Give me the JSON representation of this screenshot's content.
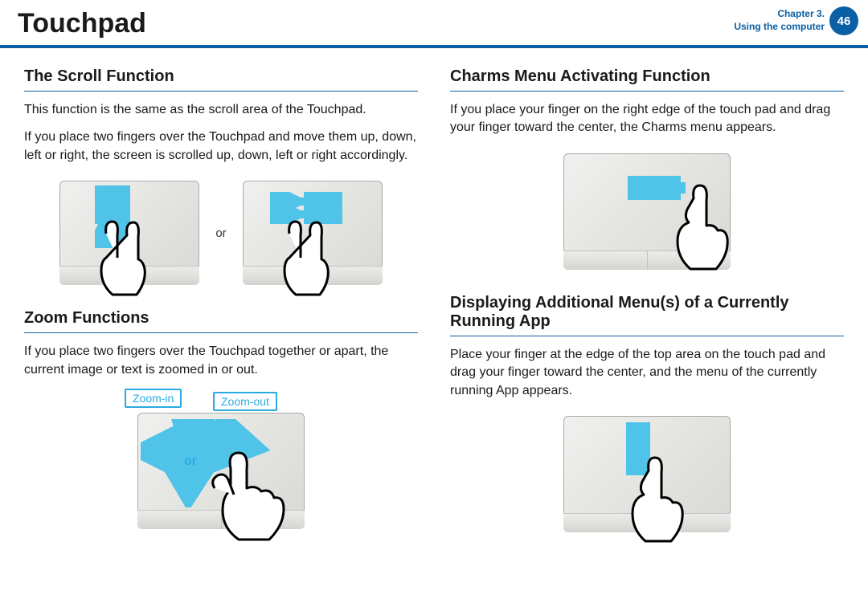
{
  "header": {
    "title": "Touchpad",
    "chapter_line1": "Chapter 3.",
    "chapter_line2": "Using the computer",
    "page_number": "46"
  },
  "left": {
    "scroll": {
      "heading": "The Scroll Function",
      "p1": "This function is the same as the scroll area of the Touchpad.",
      "p2": "If you place two fingers over the Touchpad and move them up, down, left or right, the screen is scrolled up, down, left or right accordingly.",
      "or": "or"
    },
    "zoom": {
      "heading": "Zoom Functions",
      "p1": "If you place two fingers over the Touchpad together or apart, the current image or text is zoomed in or out.",
      "zoom_in": "Zoom-in",
      "zoom_out": "Zoom-out",
      "or": "or"
    }
  },
  "right": {
    "charms": {
      "heading": "Charms Menu Activating Function",
      "p1": "If you place your finger on the right edge of the touch pad and drag your finger toward the center, the Charms menu appears."
    },
    "addmenu": {
      "heading": "Displaying Additional Menu(s) of a Currently Running App",
      "p1": "Place your finger at the edge of the top area on the touch pad and drag your finger toward the center, and the menu of the currently running App appears."
    }
  }
}
